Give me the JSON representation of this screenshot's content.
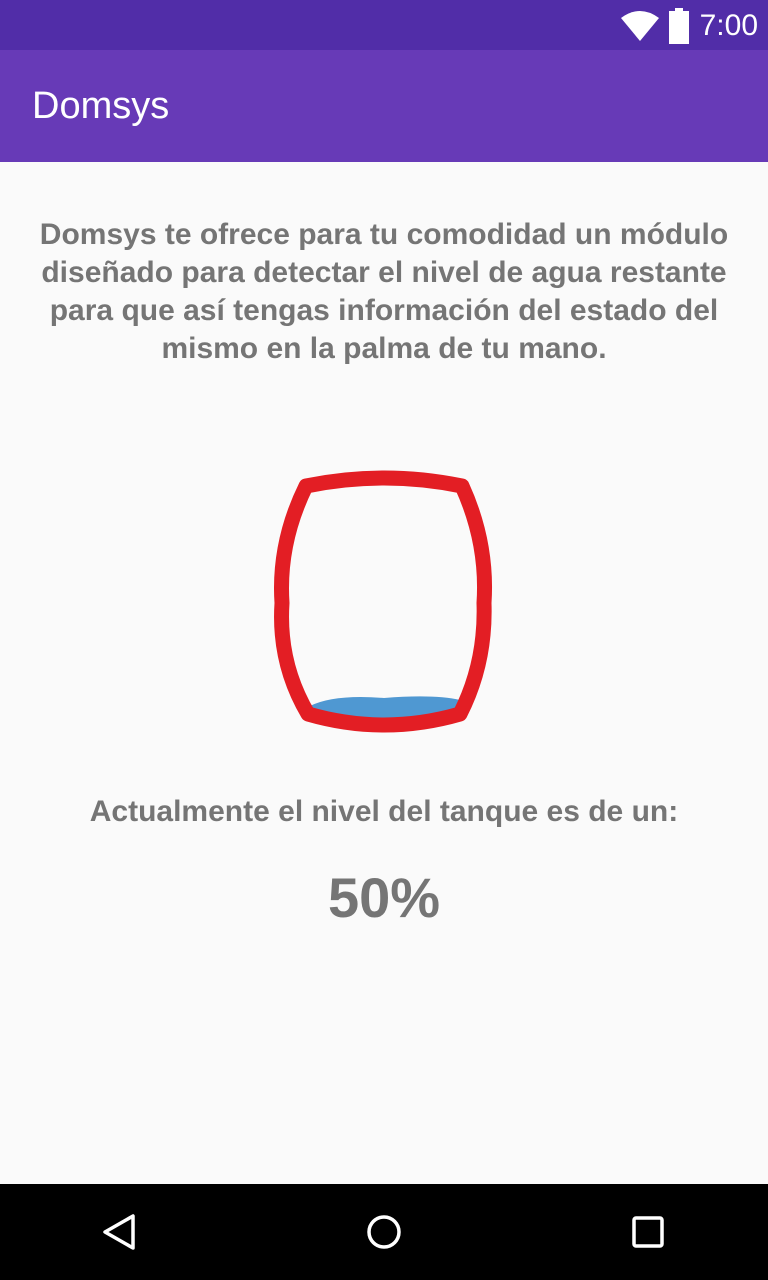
{
  "status_bar": {
    "time": "7:00",
    "icons": [
      "wifi-icon",
      "battery-icon"
    ]
  },
  "app_bar": {
    "title": "Domsys"
  },
  "main": {
    "description": "Domsys te ofrece para tu comodidad un módulo diseñado para detectar el nivel de agua restante para que así tengas información del estado del mismo en la palma de tu mano.",
    "level_label": "Actualmente el nivel del tanque es de un:",
    "level_value": "50%"
  },
  "tank": {
    "outline_color": "#e31e24",
    "water_color": "#4f98d2"
  },
  "nav_bar": {
    "icons": [
      "back-icon",
      "home-icon",
      "recents-icon"
    ]
  },
  "colors": {
    "status_bar": "#512da8",
    "app_bar": "#673ab7",
    "text": "#757575",
    "background": "#fafafa"
  }
}
